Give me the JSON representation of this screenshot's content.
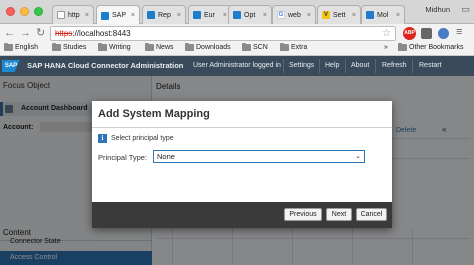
{
  "browser": {
    "tabs": [
      {
        "label": "http",
        "icon": "doc-icon"
      },
      {
        "label": "SAP",
        "icon": "sap-icon"
      },
      {
        "label": "Rep",
        "icon": "sap-icon"
      },
      {
        "label": "Eur",
        "icon": "sap-icon"
      },
      {
        "label": "Opt",
        "icon": "sap-icon"
      },
      {
        "label": "web",
        "icon": "google-icon"
      },
      {
        "label": "Sett",
        "icon": "yellow-icon"
      },
      {
        "label": "Mol",
        "icon": "sap-icon"
      }
    ],
    "active_tab_index": 1,
    "profile_name": "Midhun",
    "url_scheme": "https",
    "url_rest": "://localhost:8443",
    "extension_badge": "ABP",
    "bookmarks": [
      "English",
      "Studies",
      "Writing",
      "News",
      "Downloads",
      "SCN",
      "Extra"
    ],
    "more_bookmarks_chevron": "»",
    "other_bookmarks": "Other Bookmarks"
  },
  "sap": {
    "logo": "SAP",
    "title": "SAP HANA Cloud Connector Administration",
    "user_status": "User Administrator logged in",
    "nav": [
      "Settings",
      "Help",
      "About",
      "Refresh",
      "Restart"
    ]
  },
  "left": {
    "focus_object": "Focus Object",
    "account_dashboard": "Account Dashboard",
    "account_label": "Account:",
    "content_heading": "Content",
    "nav_items": [
      "Connector State",
      "Access Control"
    ]
  },
  "right": {
    "details_title": "Details",
    "delete_label": "Delete",
    "chevrons": "«"
  },
  "dialog": {
    "title": "Add System Mapping",
    "info_text": "Select principal type",
    "principal_label": "Principal Type:",
    "principal_value": "None",
    "buttons": {
      "previous": "Previous",
      "next": "Next",
      "cancel": "Cancel"
    }
  },
  "colors": {
    "sap_header": "#3a4a5a",
    "selection_blue": "#2f74b5",
    "dialog_footer": "#3a3a3a"
  }
}
